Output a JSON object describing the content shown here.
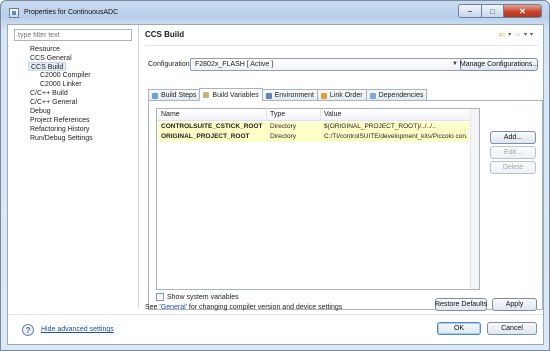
{
  "window": {
    "title": "Properties for ContinuousADC"
  },
  "sidebar": {
    "filter_placeholder": "type filter text",
    "items": [
      {
        "label": "Resource"
      },
      {
        "label": "CCS General"
      },
      {
        "label": "CCS Build"
      },
      {
        "label": "C2000 Compiler"
      },
      {
        "label": "C2000 Linker"
      },
      {
        "label": "C/C++ Build"
      },
      {
        "label": "C/C++ General"
      },
      {
        "label": "Debug"
      },
      {
        "label": "Project References"
      },
      {
        "label": "Refactoring History"
      },
      {
        "label": "Run/Debug Settings"
      }
    ]
  },
  "page": {
    "title": "CCS Build",
    "configuration_label": "Configuration:",
    "configuration_value": "F2802x_FLASH  [ Active ]",
    "manage_button": "Manage Configurations...",
    "tabs": [
      {
        "label": "Build Steps",
        "icon": "steps-icon"
      },
      {
        "label": "Build Variables",
        "icon": "variables-icon"
      },
      {
        "label": "Environment",
        "icon": "environment-icon"
      },
      {
        "label": "Link Order",
        "icon": "link-order-icon"
      },
      {
        "label": "Dependencies",
        "icon": "dependencies-icon"
      }
    ],
    "active_tab": "Build Variables",
    "table": {
      "columns": [
        "Name",
        "Type",
        "Value"
      ],
      "rows": [
        {
          "name": "CONTROLSUITE_CSTICK_ROOT",
          "type": "Directory",
          "value": "${ORIGINAL_PROJECT_ROOT}/../../.."
        },
        {
          "name": "ORIGINAL_PROJECT_ROOT",
          "type": "Directory",
          "value": "C:/TI/controlSUITE/development_kits/Piccolo con..."
        }
      ]
    },
    "side_buttons": {
      "add": "Add...",
      "edit": "Edit...",
      "delete": "Delete"
    },
    "show_system_variables": "Show system variables",
    "hint_prefix": "See ",
    "hint_link": "'General'",
    "hint_suffix": " for changing compiler version and device settings",
    "restore_defaults": "Restore Defaults",
    "apply": "Apply"
  },
  "footer": {
    "help_link": "Hide advanced settings",
    "ok": "OK",
    "cancel": "Cancel"
  },
  "colors": {
    "highlight_row": "#ffffc8",
    "link": "#1a4fb5",
    "close_button": "#c8442c",
    "back_arrow": "#e0a321"
  }
}
